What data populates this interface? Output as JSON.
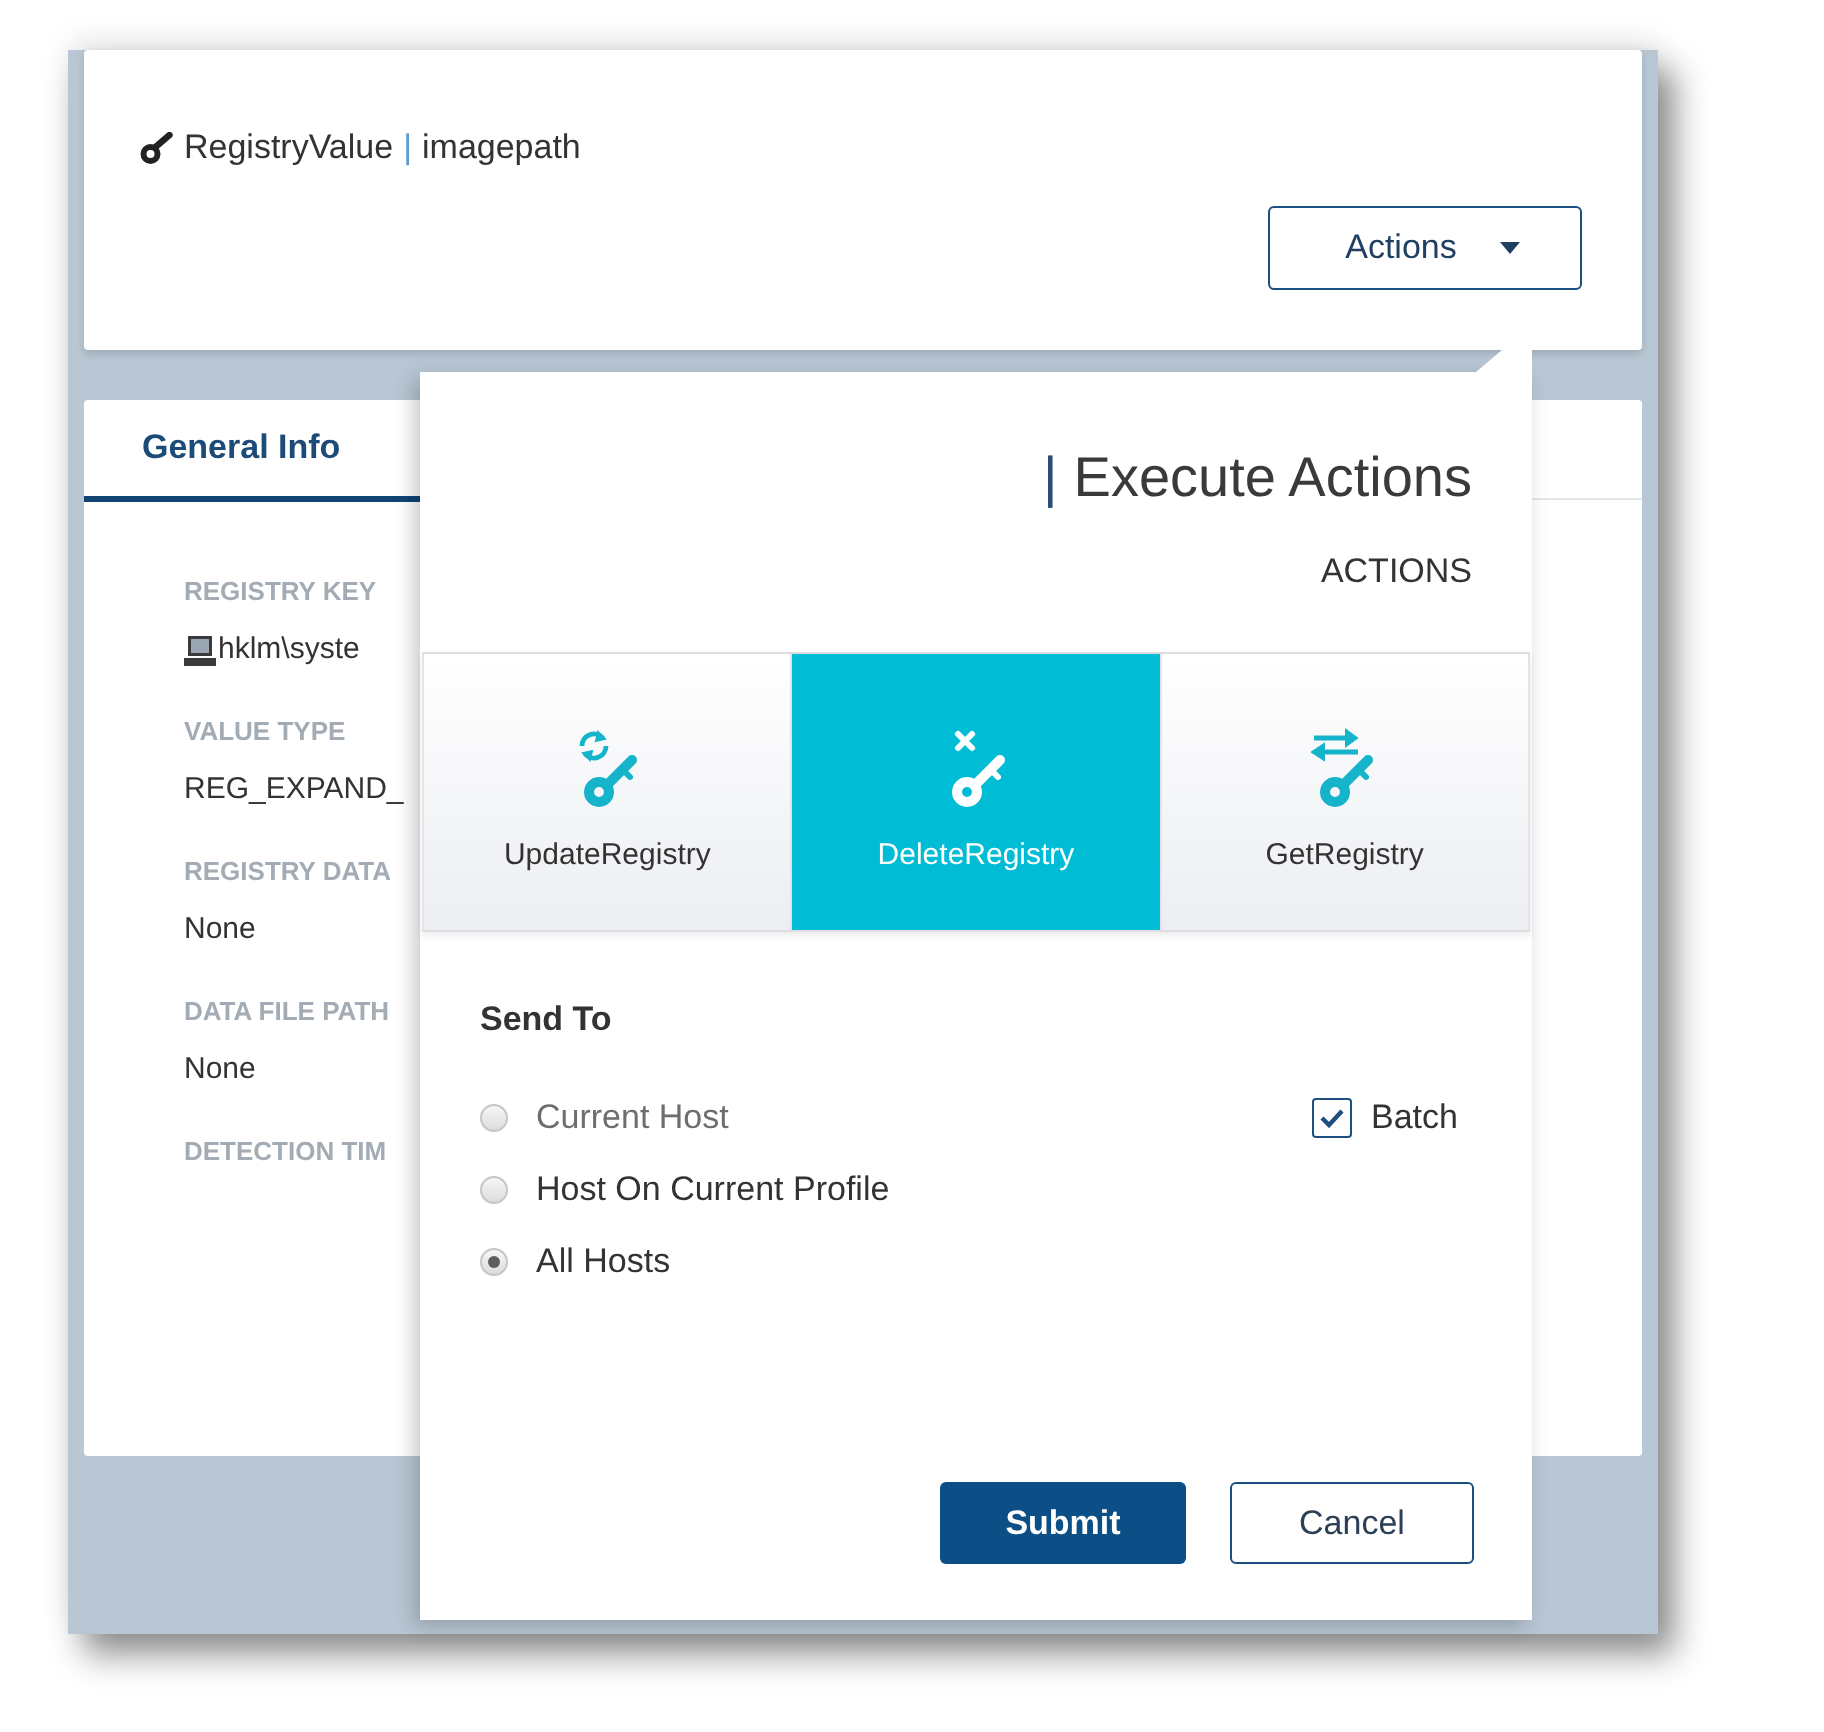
{
  "record": {
    "type": "RegistryValue",
    "separator": "|",
    "name": "imagepath",
    "actions_button": "Actions"
  },
  "details": {
    "tabs": [
      {
        "label": "General Info",
        "selected": true
      }
    ],
    "fields": [
      {
        "label": "REGISTRY KEY",
        "value": "hklm\\syste",
        "kind": "host"
      },
      {
        "label": "VALUE TYPE",
        "value": "REG_EXPAND_",
        "kind": "text"
      },
      {
        "label": "REGISTRY DATA",
        "value": "None",
        "kind": "text"
      },
      {
        "label": "DATA FILE PATH",
        "value": "None",
        "kind": "text"
      },
      {
        "label": "DETECTION TIM",
        "kind": "text"
      }
    ]
  },
  "panel": {
    "title_separator": "|",
    "title": "Execute Actions",
    "subtitle": "ACTIONS",
    "actions": [
      {
        "label": "UpdateRegistry",
        "kind": "update",
        "selected": false
      },
      {
        "label": "DeleteRegistry",
        "kind": "delete",
        "selected": true
      },
      {
        "label": "GetRegistry",
        "kind": "get",
        "selected": false
      }
    ],
    "send_to": {
      "label": "Send To",
      "options": [
        {
          "label": "Current Host",
          "selected": false,
          "disabled": true
        },
        {
          "label": "Host On Current Profile",
          "selected": false,
          "disabled": false
        },
        {
          "label": "All Hosts",
          "selected": true,
          "disabled": false
        }
      ]
    },
    "batch": {
      "label": "Batch",
      "checked": true
    },
    "buttons": [
      {
        "label": "Submit",
        "kind": "primary"
      },
      {
        "label": "Cancel",
        "kind": "secondary"
      }
    ]
  }
}
